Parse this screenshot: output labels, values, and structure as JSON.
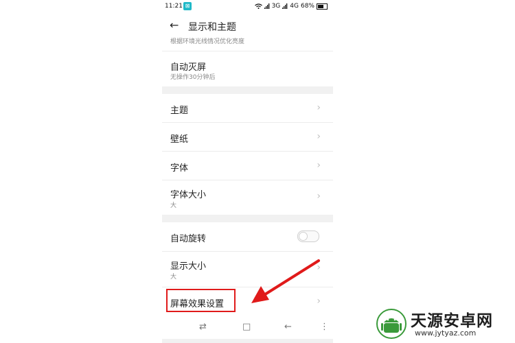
{
  "status_bar": {
    "time": "11:21",
    "app_icon_glyph": "⊠",
    "signal_3g": "3G",
    "signal_4g": "4G",
    "battery": "68%"
  },
  "header": {
    "title": "显示和主题",
    "back_icon": "arrow-left-icon"
  },
  "section1": {
    "partial_subtitle": "根据环境光线情况优化亮度",
    "auto_lock": {
      "title": "自动灭屏",
      "subtitle": "无操作30分钟后"
    }
  },
  "section2": {
    "items": [
      {
        "title": "主题"
      },
      {
        "title": "壁纸"
      },
      {
        "title": "字体"
      },
      {
        "title": "字体大小",
        "subtitle": "大"
      }
    ]
  },
  "section3": {
    "auto_rotate": {
      "title": "自动旋转",
      "enabled": false
    },
    "display_size": {
      "title": "显示大小",
      "subtitle": "大"
    },
    "screen_effect": {
      "title": "屏幕效果设置"
    }
  },
  "nav_bar": {
    "recents_glyph": "⇄",
    "home_glyph": "□",
    "back_glyph": "←",
    "menu_glyph": "⋮"
  },
  "watermark": {
    "title": "天源安卓网",
    "url": "www.jytyaz.com"
  },
  "colors": {
    "annotation_red": "#e01a1a",
    "logo_green": "#3a9a3a"
  }
}
